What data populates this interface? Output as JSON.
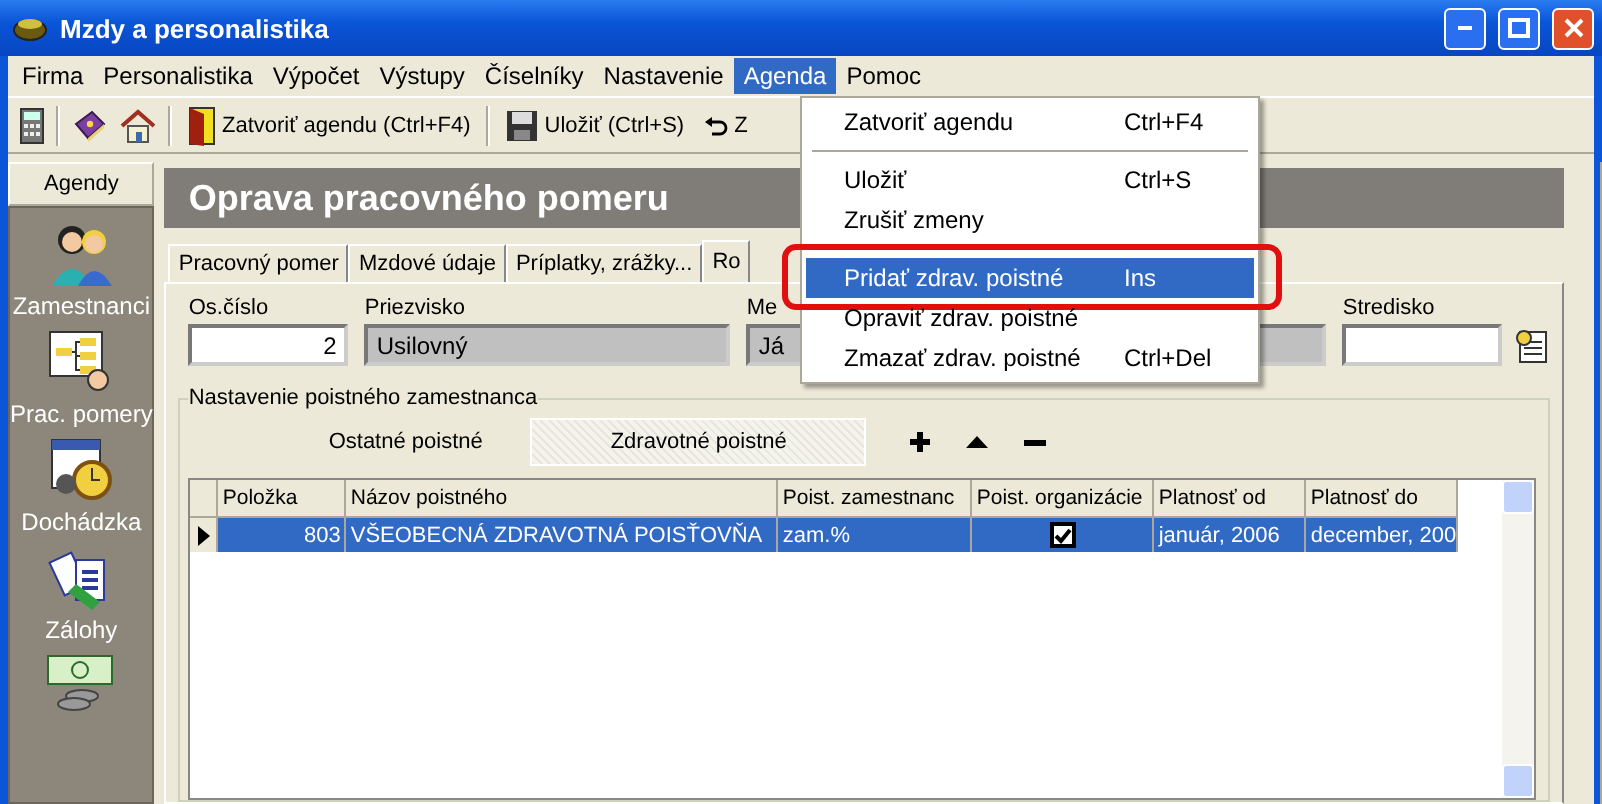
{
  "window": {
    "title": "Mzdy a personalistika"
  },
  "menu": [
    {
      "label": "Firma",
      "selected": false
    },
    {
      "label": "Personalistika",
      "selected": false
    },
    {
      "label": "Výpočet",
      "selected": false
    },
    {
      "label": "Výstupy",
      "selected": false
    },
    {
      "label": "Číselníky",
      "selected": false
    },
    {
      "label": "Nastavenie",
      "selected": false
    },
    {
      "label": "Agenda",
      "selected": true
    },
    {
      "label": "Pomoc",
      "selected": false
    }
  ],
  "toolbar": [
    {
      "kind": "icon"
    },
    {
      "kind": "separator"
    },
    {
      "kind": "icon"
    },
    {
      "kind": "icon"
    },
    {
      "kind": "separator"
    },
    {
      "kind": "button",
      "label": "Zatvoriť agendu (Ctrl+F4)"
    },
    {
      "kind": "separator"
    },
    {
      "kind": "button",
      "label": "Uložiť (Ctrl+S)"
    },
    {
      "kind": "button",
      "label": "Z"
    }
  ],
  "dropdown": [
    {
      "kind": "item",
      "label": "Zatvoriť agendu",
      "shortcut": "Ctrl+F4",
      "selected": false,
      "annotated": false
    },
    {
      "kind": "separator"
    },
    {
      "kind": "item",
      "label": "Uložiť",
      "shortcut": "Ctrl+S",
      "selected": false,
      "annotated": false
    },
    {
      "kind": "item",
      "label": "Zrušiť zmeny",
      "selected": false,
      "annotated": false
    },
    {
      "kind": "separator"
    },
    {
      "kind": "item",
      "label": "Pridať zdrav. poistné",
      "shortcut": "Ins",
      "selected": true,
      "annotated": true
    },
    {
      "kind": "item",
      "label": "Opraviť zdrav. poistné",
      "selected": false,
      "annotated": false
    },
    {
      "kind": "item",
      "label": "Zmazať zdrav. poistné",
      "shortcut": "Ctrl+Del",
      "selected": false,
      "annotated": false
    }
  ],
  "sidebar": {
    "title": "Agendy",
    "items": [
      {
        "label": "Zamestnanci"
      },
      {
        "label": "Prac. pomery"
      },
      {
        "label": "Dochádzka"
      },
      {
        "label": "Zálohy"
      }
    ]
  },
  "page_title": "Oprava pracovného pomeru",
  "tabs": [
    {
      "label": "Pracovný pomer",
      "selected": false
    },
    {
      "label": "Mzdové údaje",
      "selected": false
    },
    {
      "label": "Príplatky, zrážky...",
      "selected": false
    },
    {
      "label": "Ro",
      "selected": true
    }
  ],
  "fields": [
    {
      "label": "Os.číslo",
      "value": "2",
      "kind": "number"
    },
    {
      "label": "Priezvisko",
      "value": "Usilovný",
      "kind": "readonly"
    },
    {
      "label": "Me",
      "value": "Já",
      "kind": "readonly"
    },
    {
      "label": "Stredisko",
      "kind": "lookup"
    }
  ],
  "group": {
    "title": "Nastavenie poistného zamestnanca",
    "subtabs": [
      {
        "label": "Ostatné poistné",
        "selected": false
      },
      {
        "label": "Zdravotné poistné",
        "selected": true
      }
    ],
    "table": {
      "columns": [
        "Položka",
        "Názov poistného",
        "Poist. zamestnanc",
        "Poist. organizácie",
        "Platnosť od",
        "Platnosť do"
      ],
      "rows": [
        {
          "selected": true,
          "item": "803",
          "name": "VŠEOBECNÁ ZDRAVOTNÁ POISŤOVŇA",
          "employee": "zam.%",
          "employer_checked": true,
          "from": "január, 2006",
          "to": "december, 200"
        }
      ]
    }
  }
}
